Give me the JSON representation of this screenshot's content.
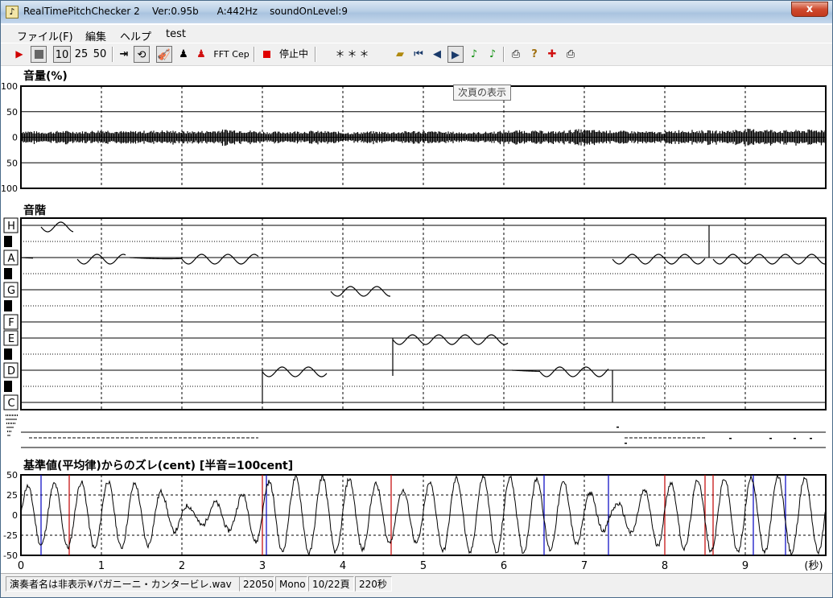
{
  "window": {
    "title": "RealTimePitchChecker 2    Ver:0.95b      A:442Hz    soundOnLevel:9",
    "close_label": "x"
  },
  "menu": [
    "ファイル(F)",
    "編集",
    "ヘルプ",
    "test"
  ],
  "toolbar": {
    "zoom_options": [
      "10",
      "25",
      "50"
    ],
    "zoom_selected": "10",
    "fft_label": "FFT",
    "cep_label": "Cep",
    "status_text": "停止中",
    "display_text": "＊＊＊",
    "icons": [
      "play-icon",
      "stop-icon",
      "zoom-10",
      "zoom-25",
      "zoom-50",
      "step-to-end-icon",
      "loop-icon",
      "violin-icon",
      "singer-icon",
      "singer-red-icon",
      "fft-button",
      "cep-button",
      "record-icon",
      "open-folder-icon",
      "first-page-icon",
      "prev-page-icon",
      "next-page-icon",
      "note-green-icon",
      "note-green2-icon",
      "print-icon",
      "help-icon",
      "marker-icon",
      "printer2-icon"
    ]
  },
  "tooltip": "次頁の表示",
  "panels": {
    "volume": {
      "title": "音量(%)",
      "y_ticks": [
        "100",
        "50",
        "0",
        "50",
        "100"
      ]
    },
    "scale": {
      "title": "音階",
      "note_labels": [
        "H",
        "A",
        "G",
        "F",
        "E",
        "D",
        "C"
      ]
    },
    "deviation": {
      "title": "基準値(平均律)からのズレ(cent) [半音=100cent]",
      "y_ticks": [
        "50",
        "25",
        "0",
        "-25",
        "-50"
      ]
    }
  },
  "x_axis": {
    "ticks": [
      "0",
      "1",
      "2",
      "3",
      "4",
      "5",
      "6",
      "7",
      "8",
      "9"
    ],
    "unit_label": "(秒)"
  },
  "statusbar": {
    "file": "演奏者名は非表示¥パガニーニ・カンタービレ.wav",
    "sample_rate": "22050",
    "channel": "Mono",
    "page": "10/22頁",
    "duration": "220秒"
  },
  "chart_data": [
    {
      "type": "area",
      "title": "音量(%)",
      "x_range_sec": [
        0,
        10
      ],
      "ylim": [
        -100,
        100
      ],
      "grid": true,
      "series": [
        {
          "values_envelope_percent": [
            14,
            11,
            13,
            12,
            15,
            12,
            13,
            14,
            12,
            13,
            16,
            14,
            11,
            12,
            13,
            12,
            10,
            12,
            11,
            13,
            12,
            11,
            10,
            12,
            14,
            13,
            12,
            16,
            14,
            13,
            12,
            11,
            15,
            14,
            13,
            17,
            16,
            14,
            15,
            16
          ]
        }
      ]
    },
    {
      "type": "line",
      "title": "音階",
      "x_range_sec": [
        0,
        10
      ],
      "y_categories": [
        "C",
        "D",
        "E",
        "F",
        "G",
        "A",
        "H"
      ],
      "segments": [
        {
          "x": [
            0.0,
            0.15
          ],
          "note": "A",
          "vibrato": false
        },
        {
          "x": [
            0.25,
            0.65
          ],
          "note": "H",
          "vibrato": true
        },
        {
          "x": [
            0.7,
            1.3
          ],
          "note": "A",
          "vibrato": true
        },
        {
          "x": [
            1.35,
            2.0
          ],
          "note": "A",
          "vibrato": false
        },
        {
          "x": [
            2.0,
            2.95
          ],
          "note": "A",
          "vibrato": true
        },
        {
          "x": [
            3.0,
            3.8
          ],
          "note": "D",
          "vibrato": true
        },
        {
          "x": [
            3.85,
            4.6
          ],
          "note": "G",
          "vibrato": true
        },
        {
          "x": [
            4.62,
            6.05
          ],
          "note": "E",
          "vibrato": true
        },
        {
          "x": [
            6.1,
            6.45
          ],
          "note": "D",
          "vibrato": false
        },
        {
          "x": [
            6.45,
            7.3
          ],
          "note": "D",
          "vibrato": true
        },
        {
          "x": [
            7.35,
            8.5
          ],
          "note": "A",
          "vibrato": true
        },
        {
          "x": [
            8.6,
            10.0
          ],
          "note": "A",
          "vibrato": true
        }
      ]
    },
    {
      "type": "line",
      "title": "基準値(平均律)からのズレ(cent) [半音=100cent]",
      "x_range_sec": [
        0,
        10
      ],
      "ylim": [
        -50,
        50
      ],
      "grid": true,
      "series": [
        {
          "name": "",
          "description_values_cent_amplitude": [
            35,
            40,
            42,
            38,
            10,
            20,
            45,
            48,
            44,
            30,
            45,
            48,
            46,
            40,
            12,
            38,
            44,
            46,
            48,
            45
          ]
        }
      ]
    }
  ]
}
